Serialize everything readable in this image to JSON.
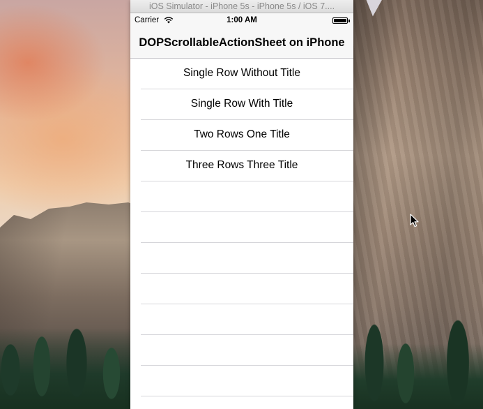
{
  "simulator": {
    "window_title": "iOS Simulator - iPhone 5s - iPhone 5s / iOS 7...."
  },
  "status_bar": {
    "carrier": "Carrier",
    "time": "1:00 AM",
    "wifi_icon": "wifi-icon",
    "battery_icon": "battery-full-icon"
  },
  "nav_bar": {
    "title": "DOPScrollableActionSheet on iPhone"
  },
  "table": {
    "rows": [
      {
        "label": "Single Row Without Title"
      },
      {
        "label": "Single Row With Title"
      },
      {
        "label": "Two Rows One Title"
      },
      {
        "label": "Three Rows Three Title"
      },
      {
        "label": ""
      },
      {
        "label": ""
      },
      {
        "label": ""
      },
      {
        "label": ""
      },
      {
        "label": ""
      },
      {
        "label": ""
      },
      {
        "label": ""
      },
      {
        "label": ""
      }
    ]
  },
  "colors": {
    "separator": "#d6d6da",
    "nav_background": "#f7f7f7",
    "titlebar_text": "#8a8a8a"
  }
}
